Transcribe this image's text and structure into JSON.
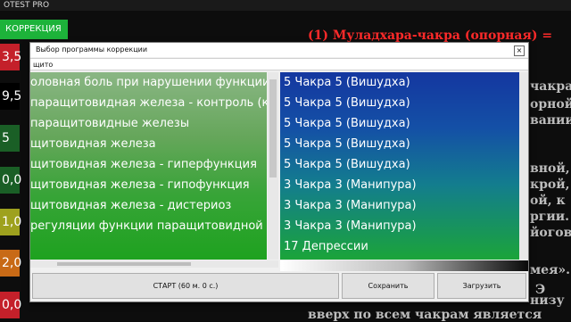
{
  "app_title": "OTEST PRO",
  "correction_tab_label": "КОРРЕКЦИЯ",
  "left_values": [
    {
      "text": "3,5",
      "color": "#c4202a"
    },
    {
      "text": "9,5",
      "color": "#000000"
    },
    {
      "text": "5",
      "color": "#1a5f26"
    },
    {
      "text": "0,0",
      "color": "#1a5f26"
    },
    {
      "text": "1,0",
      "color": "#9ea11e"
    },
    {
      "text": "2,0",
      "color": "#c86a16"
    },
    {
      "text": "0,0",
      "color": "#c4202a"
    }
  ],
  "background_title": "(1) Муладхара-чакра (опорная) =",
  "background_lines": [
    "чакра,",
    "орной,",
    "вании",
    "вной,",
    "крой,",
    "ой, к",
    "ргии.",
    "йогов",
    "мея».",
    "Э",
    "низу",
    "вверх по всем чакрам является"
  ],
  "dialog": {
    "title": "Выбор программы коррекции",
    "close_glyph": "×",
    "search_value": "щито",
    "left_items": [
      "оловная боль при нарушении функции",
      "паращитовидная железа - контроль (ка",
      "паращитовидные железы",
      "щитовидная железа",
      "щитовидная железа - гиперфункция",
      "щитовидная железа - гипофункция",
      "щитовидная железа - дистериоз",
      "регуляции функции паращитовидной ж",
      ""
    ],
    "right_items": [
      "5 Чакра 5 (Вишудха)",
      "5 Чакра 5 (Вишудха)",
      "5 Чакра 5 (Вишудха)",
      "5 Чакра 5 (Вишудха)",
      "5 Чакра 5 (Вишудха)",
      "3 Чакра 3 (Манипура)",
      "3 Чакра 3 (Манипура)",
      "3 Чакра 3 (Манипура)",
      "17 Депрессии"
    ],
    "buttons": {
      "start": "СТАРТ (60 м. 0 с.)",
      "save": "Сохранить",
      "load": "Загрузить"
    }
  }
}
